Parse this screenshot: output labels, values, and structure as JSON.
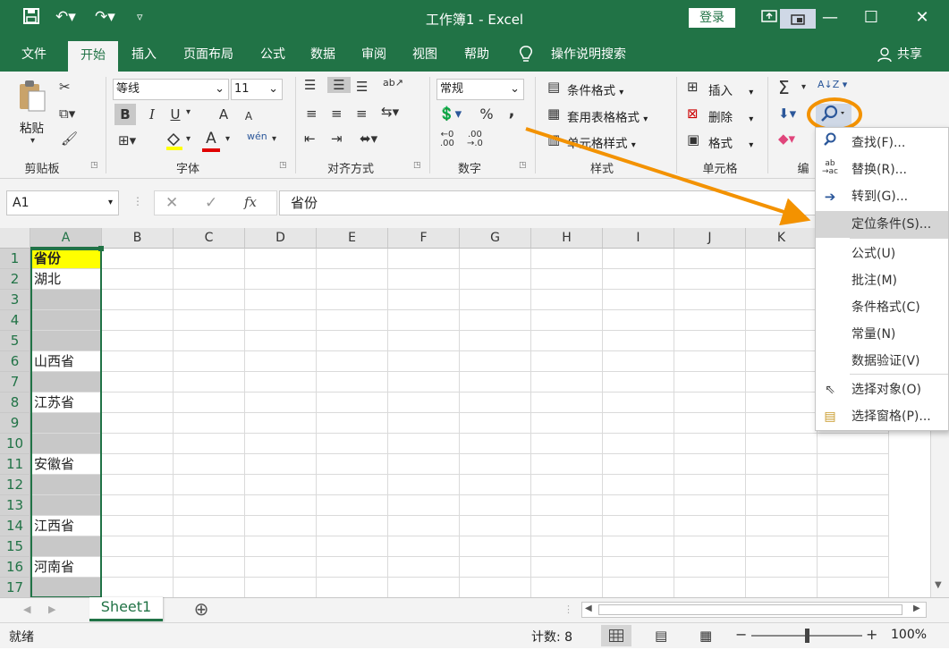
{
  "titlebar": {
    "title": "工作簿1 - Excel",
    "login": "登录",
    "quick_access": [
      "save-icon",
      "undo-icon",
      "redo-icon",
      "customize-icon"
    ]
  },
  "tabs": [
    "文件",
    "开始",
    "插入",
    "页面布局",
    "公式",
    "数据",
    "审阅",
    "视图",
    "帮助",
    "操作说明搜索",
    "共享"
  ],
  "ribbon": {
    "clipboard": {
      "paste": "粘贴",
      "label": "剪贴板"
    },
    "font": {
      "name": "等线",
      "size": "11",
      "label": "字体",
      "bold": "B",
      "italic": "I",
      "underline": "U",
      "grow": "A",
      "shrink": "A",
      "font_color": "A",
      "phonetic": "wén"
    },
    "alignment": {
      "label": "对齐方式"
    },
    "number": {
      "format": "常规",
      "label": "数字",
      "percent": "%",
      "comma": ","
    },
    "styles": {
      "conditional": "条件格式",
      "table": "套用表格格式",
      "cell": "单元格样式",
      "label": "样式"
    },
    "cells": {
      "insert": "插入",
      "delete": "删除",
      "format": "格式",
      "label": "单元格"
    },
    "editing": {
      "label": "编"
    }
  },
  "formula_bar": {
    "name_box": "A1",
    "fx": "fx",
    "content": "省份"
  },
  "columns": [
    "A",
    "B",
    "C",
    "D",
    "E",
    "F",
    "G",
    "H",
    "I",
    "J",
    "K"
  ],
  "rows": [
    {
      "num": "1",
      "a": "省份"
    },
    {
      "num": "2",
      "a": "湖北"
    },
    {
      "num": "3",
      "a": ""
    },
    {
      "num": "4",
      "a": ""
    },
    {
      "num": "5",
      "a": ""
    },
    {
      "num": "6",
      "a": "山西省"
    },
    {
      "num": "7",
      "a": ""
    },
    {
      "num": "8",
      "a": "江苏省"
    },
    {
      "num": "9",
      "a": ""
    },
    {
      "num": "10",
      "a": ""
    },
    {
      "num": "11",
      "a": "安徽省"
    },
    {
      "num": "12",
      "a": ""
    },
    {
      "num": "13",
      "a": ""
    },
    {
      "num": "14",
      "a": "江西省"
    },
    {
      "num": "15",
      "a": ""
    },
    {
      "num": "16",
      "a": "河南省"
    },
    {
      "num": "17",
      "a": ""
    }
  ],
  "sheet": {
    "name": "Sheet1",
    "add": "⊕"
  },
  "status": {
    "ready": "就绪",
    "count": "计数: 8",
    "zoom": "100%",
    "zoom_level": 1.0
  },
  "menu": {
    "items": [
      {
        "icon": "search-icon",
        "label": "查找(F)..."
      },
      {
        "icon": "replace-icon",
        "label": "替换(R)..."
      },
      {
        "icon": "goto-arrow-icon",
        "label": "转到(G)..."
      },
      {
        "icon": "",
        "label": "定位条件(S)..."
      },
      {
        "icon": "",
        "label": "公式(U)"
      },
      {
        "icon": "",
        "label": "批注(M)"
      },
      {
        "icon": "",
        "label": "条件格式(C)"
      },
      {
        "icon": "",
        "label": "常量(N)"
      },
      {
        "icon": "",
        "label": "数据验证(V)"
      },
      {
        "icon": "cursor-icon",
        "label": "选择对象(O)"
      },
      {
        "icon": "selection-pane-icon",
        "label": "选择窗格(P)..."
      }
    ],
    "highlighted_index": 3
  },
  "colors": {
    "excel_green": "#217346",
    "header_yellow": "#ffff00",
    "selection_gray": "#c8c8c8",
    "annotation_orange": "#f39200"
  }
}
